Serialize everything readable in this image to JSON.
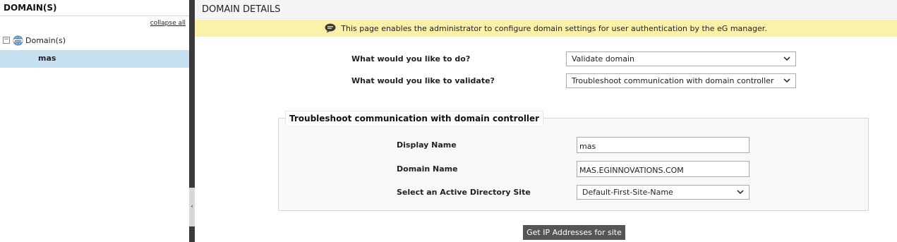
{
  "left_panel": {
    "title": "DOMAIN(S)",
    "collapse_all": "collapse all",
    "tree": {
      "root_label": "Domain(s)",
      "toggle": "−",
      "children": [
        {
          "label": "mas",
          "selected": true
        }
      ]
    }
  },
  "divider": {
    "handle_glyph": "‹"
  },
  "main": {
    "title": "DOMAIN DETAILS",
    "info": "This page enables the administrator to configure domain settings for user authentication by the eG manager.",
    "questions": [
      {
        "label": "What would you like to do?",
        "selected": "Validate domain"
      },
      {
        "label": "What would you like to validate?",
        "selected": "Troubleshoot communication with domain controller"
      }
    ],
    "section": {
      "legend": "Troubleshoot communication with domain controller",
      "display_name_label": "Display Name",
      "display_name_value": "mas",
      "domain_name_label": "Domain Name",
      "domain_name_value": "MAS.EGINNOVATIONS.COM",
      "site_label": "Select an Active Directory Site",
      "site_selected": "Default-First-Site-Name"
    },
    "button_label": "Get IP Addresses for site"
  },
  "colors": {
    "selection": "#c6dff1",
    "info_bar": "#fbf1a9",
    "divider": "#3a3a3a",
    "button": "#555555"
  },
  "icons": {
    "tree_root": "globe-www-icon",
    "info": "speech-bubble-icon",
    "select": "chevron-down-icon"
  }
}
